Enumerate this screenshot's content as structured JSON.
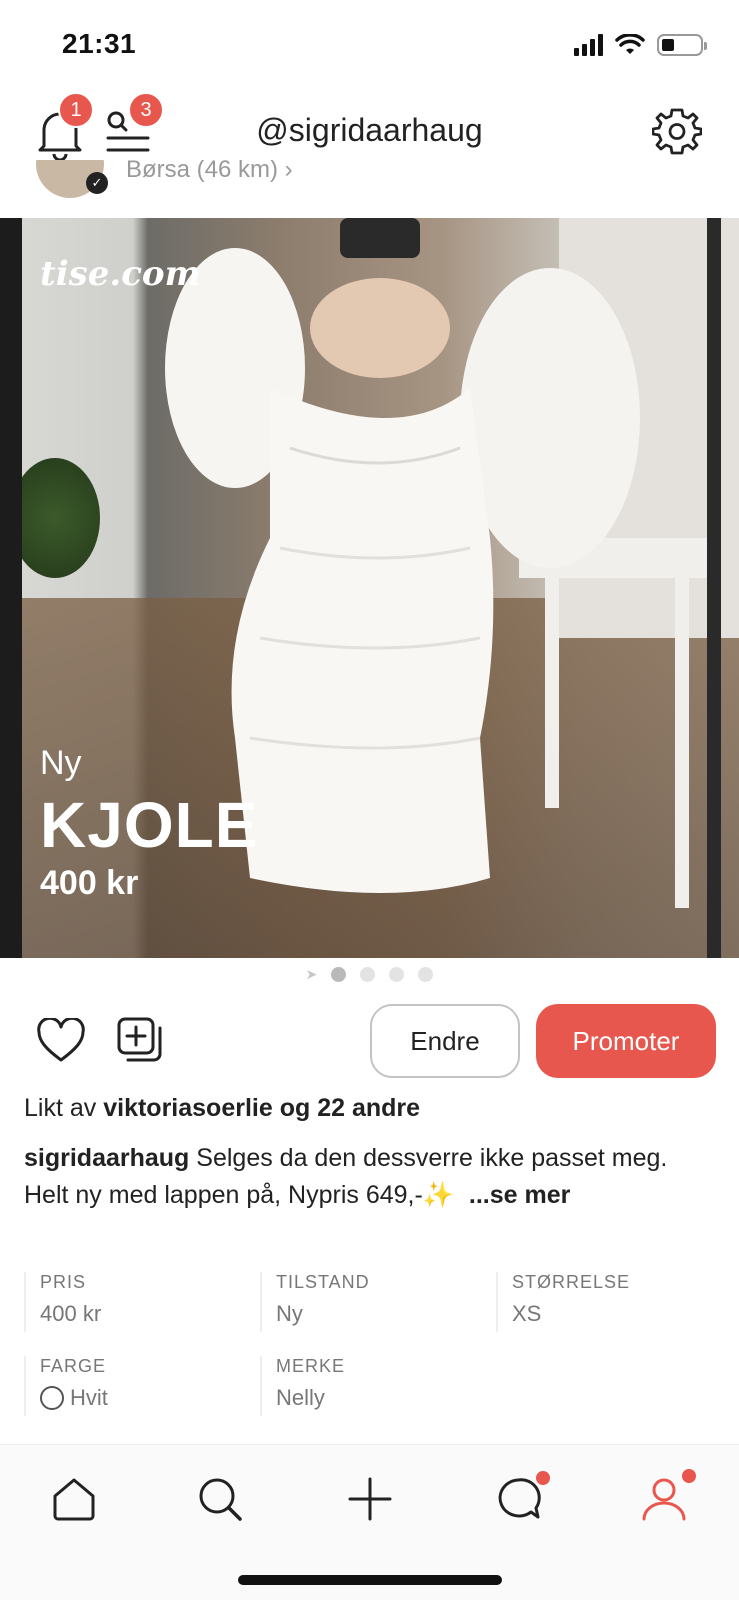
{
  "status_bar": {
    "time": "21:31"
  },
  "header": {
    "username": "@sigridaarhaug",
    "notifications_badge": "1",
    "search_badge": "3"
  },
  "seller": {
    "location": "Børsa (46 km) ›"
  },
  "photo": {
    "watermark": "tise.com",
    "condition": "Ny",
    "title": "KJOLE",
    "price": "400 kr"
  },
  "actions": {
    "edit_label": "Endre",
    "promote_label": "Promoter"
  },
  "likes": {
    "prefix": "Likt av",
    "user": "viktoriasoerlie",
    "joiner": "og",
    "others": "22 andre"
  },
  "description": {
    "author": "sigridaarhaug",
    "line1": "Selges da den dessverre ikke passet meg.",
    "line2": "Helt ny med lappen på, Nypris 649,-✨",
    "more": "...se mer"
  },
  "attributes": [
    {
      "key": "PRIS",
      "value": "400 kr"
    },
    {
      "key": "TILSTAND",
      "value": "Ny"
    },
    {
      "key": "STØRRELSE",
      "value": "XS"
    },
    {
      "key": "FARGE",
      "value": "Hvit"
    },
    {
      "key": "MERKE",
      "value": "Nelly"
    }
  ],
  "colors": {
    "accent": "#e8574d",
    "text": "#222222",
    "muted": "#777777"
  },
  "icons": [
    "bell-icon",
    "search-list-icon",
    "gear-icon",
    "heart-icon",
    "add-to-collection-icon",
    "home-icon",
    "search-icon",
    "plus-icon",
    "chat-icon",
    "profile-icon"
  ]
}
